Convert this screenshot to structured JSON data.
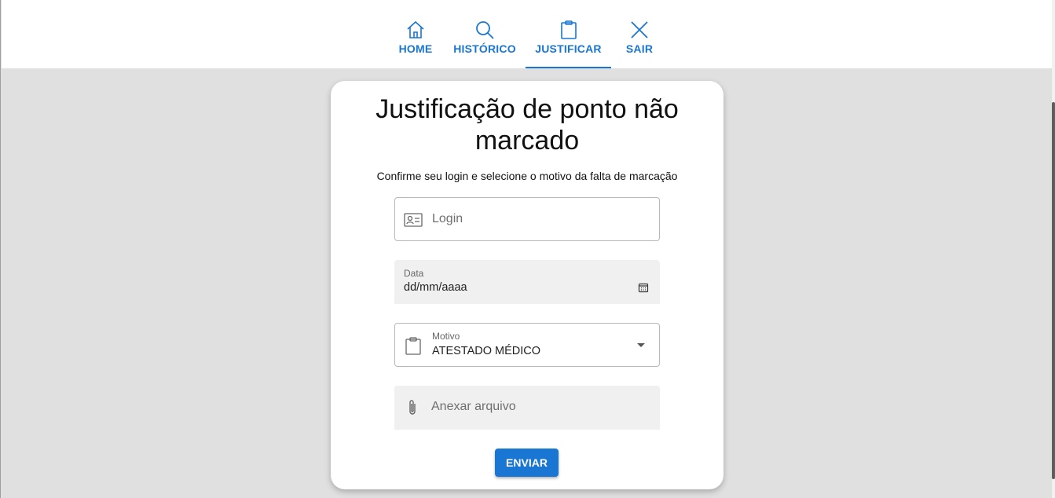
{
  "nav": {
    "accent_color": "#1976d2",
    "tabs": [
      {
        "label": "HOME",
        "icon": "home-icon"
      },
      {
        "label": "HISTÓRICO",
        "icon": "search-icon"
      },
      {
        "label": "JUSTIFICAR",
        "icon": "clipboard-icon",
        "active": true
      },
      {
        "label": "SAIR",
        "icon": "close-icon"
      }
    ]
  },
  "form": {
    "title": "Justificação de ponto não marcado",
    "subtitle": "Confirme seu login e selecione o motivo da falta de marcação",
    "login": {
      "placeholder": "Login",
      "icon": "id-card-icon"
    },
    "date": {
      "label": "Data",
      "value": "dd/mm/aaaa",
      "icon": "calendar-icon"
    },
    "reason": {
      "label": "Motivo",
      "value": "ATESTADO MÉDICO",
      "icon": "clipboard-icon"
    },
    "attachment": {
      "placeholder": "Anexar arquivo",
      "icon": "paperclip-icon"
    },
    "submit_label": "ENVIAR"
  }
}
